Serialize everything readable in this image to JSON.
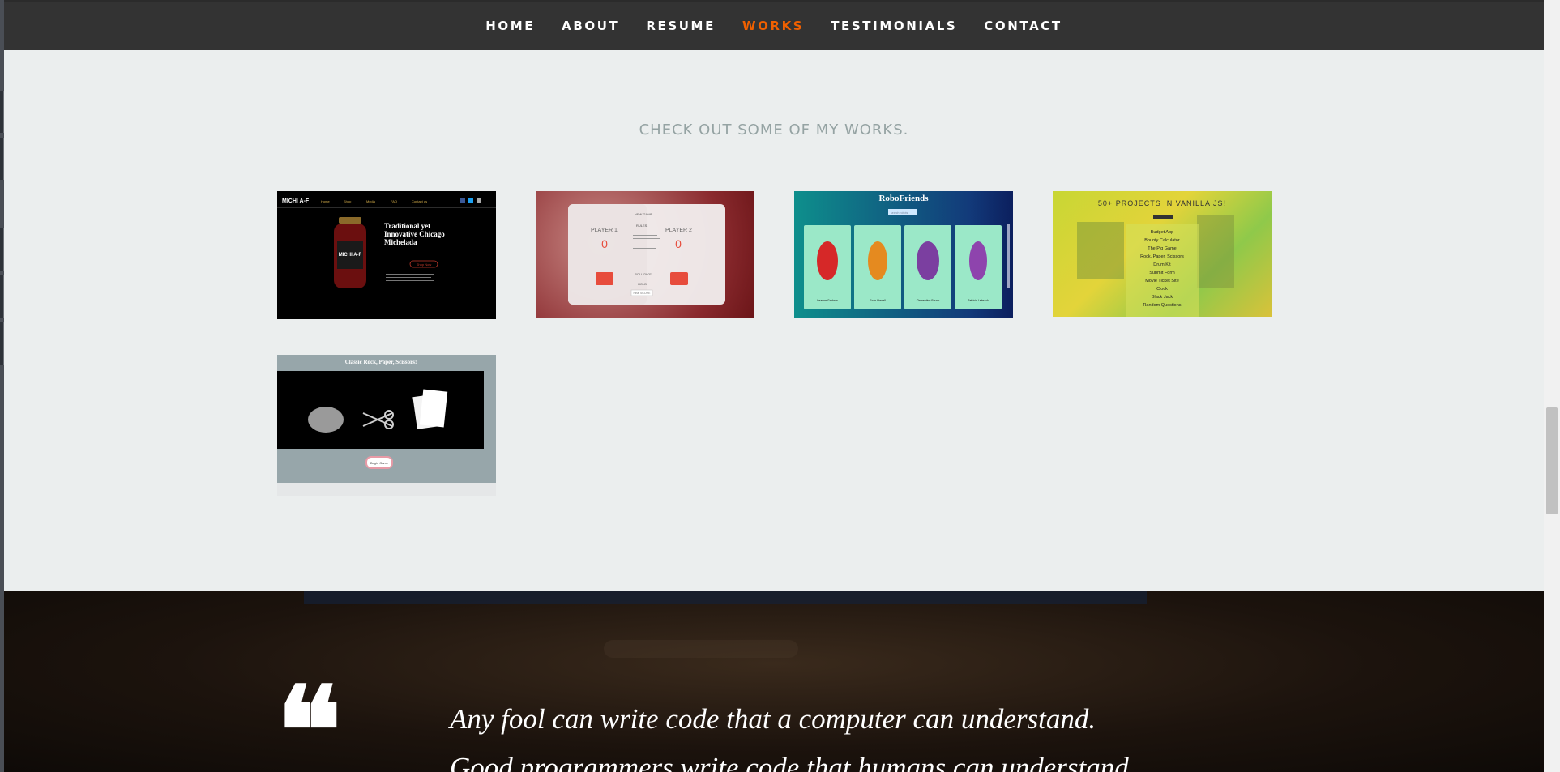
{
  "nav": {
    "items": [
      {
        "label": "HOME"
      },
      {
        "label": "ABOUT"
      },
      {
        "label": "RESUME"
      },
      {
        "label": "WORKS",
        "active": true
      },
      {
        "label": "TESTIMONIALS"
      },
      {
        "label": "CONTACT"
      }
    ],
    "active_color": "#f06000"
  },
  "works": {
    "title": "CHECK OUT SOME OF MY WORKS.",
    "projects": [
      {
        "name": "michi-af",
        "logo": "MICHI A-F",
        "nav_links": [
          "Home",
          "Shop",
          "Media",
          "FAQ",
          "Contact us"
        ],
        "jar_label": "MICHI A-F",
        "headline": "Traditional yet Innovative Chicago Michelada",
        "button": "Shop Now"
      },
      {
        "name": "pig-game",
        "new_game": "NEW GAME",
        "player1": "PLAYER 1",
        "player2": "PLAYER 2",
        "score1": "0",
        "score2": "0",
        "rules_title": "RULES",
        "roll_dice": "ROLL DICE",
        "hold": "HOLD",
        "final_score": "Final SCORE"
      },
      {
        "name": "robofriends",
        "title": "RoboFriends",
        "search_placeholder": "search robots",
        "robots": [
          "Leanne Graham",
          "Ervin Howell",
          "Clementine Bauch",
          "Patricia Lebsack"
        ]
      },
      {
        "name": "vanilla-js-projects",
        "title": "50+ PROJECTS IN VANILLA JS!",
        "list": [
          "Budget App",
          "Bounty Calculator",
          "The Pig Game",
          "Rock, Paper, Scissors",
          "Drum Kit",
          "Submit Form",
          "Movie Ticket Site",
          "Clock",
          "Black Jack",
          "Random Questions"
        ]
      },
      {
        "name": "rock-paper-scissors",
        "title": "Classic Rock, Paper, Scissors!",
        "button": "Begin Game"
      }
    ]
  },
  "testimonial": {
    "quote_mark": "❝",
    "quote": "Any fool can write code that a computer can understand. Good programmers write code that humans can understand."
  }
}
